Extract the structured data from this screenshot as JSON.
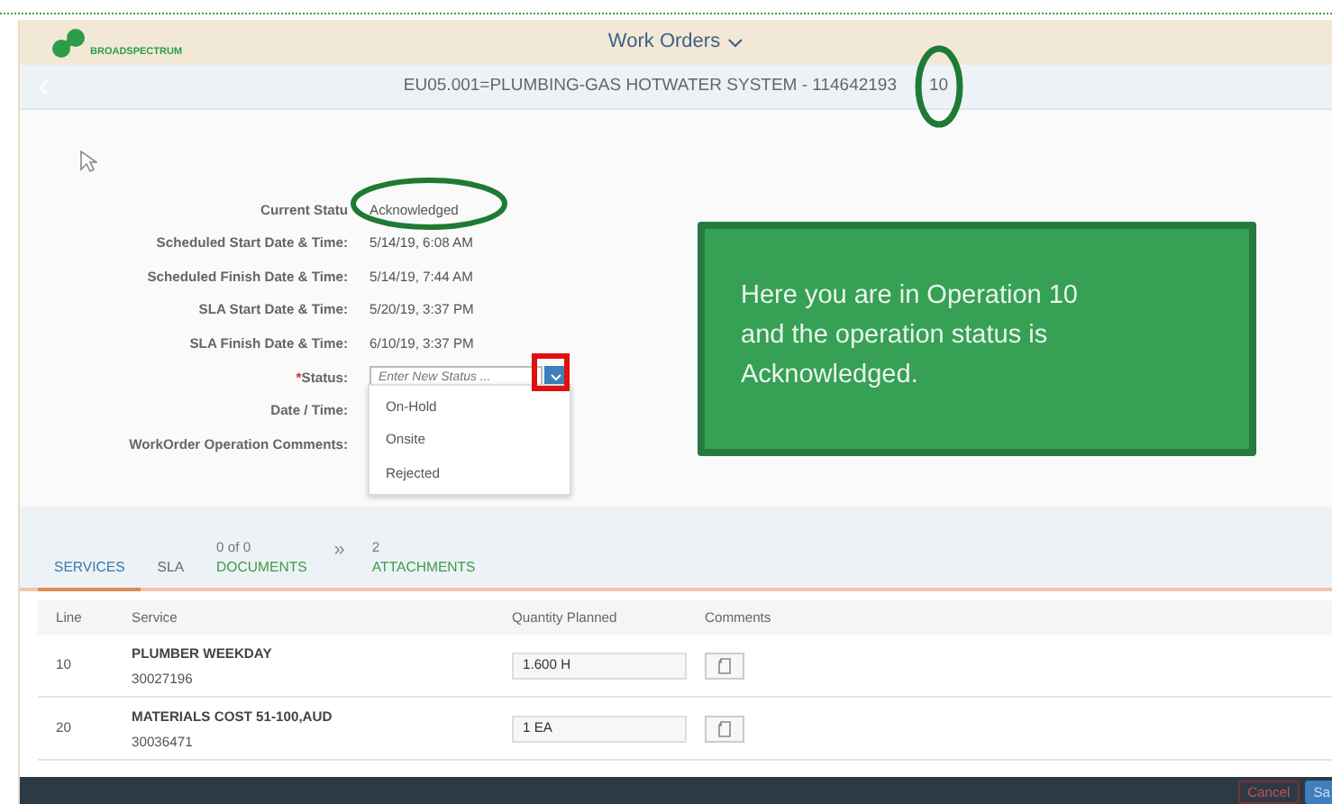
{
  "app_header": {
    "logo_text": "BROADSPECTRUM",
    "title": "Work Orders"
  },
  "object_header": {
    "title": "EU05.001=PLUMBING-GAS HOTWATER SYSTEM - 114642193",
    "operation": "10"
  },
  "form": {
    "fields": [
      {
        "kind": "text",
        "label": "Current Statu",
        "value": "Acknowledged"
      },
      {
        "kind": "text",
        "label": "Scheduled Start Date & Time:",
        "value": "5/14/19, 6:08 AM"
      },
      {
        "kind": "text",
        "label": "Scheduled Finish Date & Time:",
        "value": "5/14/19, 7:44 AM"
      },
      {
        "kind": "text",
        "label": "SLA Start Date & Time:",
        "value": "5/20/19, 3:37 PM"
      },
      {
        "kind": "text",
        "label": "SLA Finish Date & Time:",
        "value": "6/10/19, 3:37 PM"
      },
      {
        "kind": "select",
        "label": "Status:",
        "required_mark": "*",
        "placeholder": "Enter New Status ..."
      },
      {
        "kind": "blank",
        "label": "Date / Time:"
      },
      {
        "kind": "blank",
        "label": "WorkOrder Operation Comments:"
      }
    ]
  },
  "dropdown": {
    "options": [
      {
        "label": "On-Hold"
      },
      {
        "label": "Onsite"
      },
      {
        "label": "Rejected"
      }
    ]
  },
  "callout": {
    "text": "Here you are in Operation 10 and the operation status is Acknowledged."
  },
  "tabs": [
    {
      "kind": "tab",
      "label": "SERVICES",
      "selected": true,
      "color": "#3a77a8"
    },
    {
      "kind": "tab",
      "label": "SLA",
      "selected": false,
      "color": "#666666"
    },
    {
      "kind": "tab",
      "count": "0 of 0",
      "label": "DOCUMENTS",
      "selected": false,
      "color": "#3d9a47"
    },
    {
      "kind": "overflow",
      "label": "»"
    },
    {
      "kind": "tab",
      "count": "2",
      "label": "ATTACHMENTS",
      "selected": false,
      "color": "#3d9a47"
    }
  ],
  "table": {
    "columns": [
      "Line",
      "Service",
      "Quantity Planned",
      "Comments"
    ],
    "rows": [
      {
        "line": "10",
        "service": "PLUMBER WEEKDAY",
        "service_id": "30027196",
        "quantity": "1.600 H"
      },
      {
        "line": "20",
        "service": "MATERIALS COST 51-100,AUD",
        "service_id": "30036471",
        "quantity": "1 EA"
      }
    ]
  },
  "footer": {
    "buttons": [
      {
        "kind": "secondary",
        "label": "Cancel"
      },
      {
        "kind": "primary",
        "label": "Sa"
      }
    ]
  }
}
